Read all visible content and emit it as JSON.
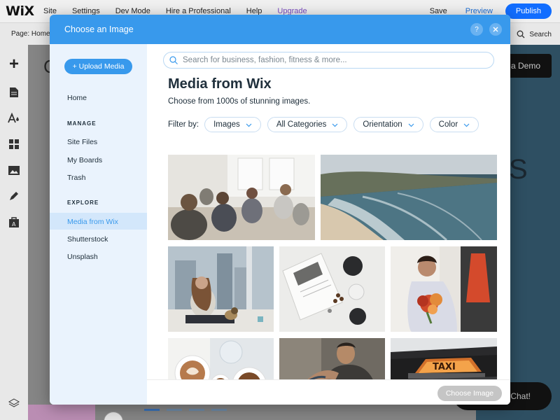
{
  "editor": {
    "logo": "WiX",
    "menu": [
      "Site",
      "Settings",
      "Dev Mode",
      "Hire a Professional",
      "Help",
      "Upgrade"
    ],
    "save": "Save",
    "preview": "Preview",
    "publish": "Publish",
    "page_label": "Page: Home",
    "search": "Search",
    "canvas_demo": "a Demo",
    "canvas_big_letter": "S",
    "canvas_chat": "Chat!",
    "canvas_c": "C"
  },
  "modal": {
    "title": "Choose an Image",
    "help_icon": "question-icon",
    "close_icon": "close-icon",
    "upload_label": "+ Upload Media",
    "nav_home": "Home",
    "section_manage": "MANAGE",
    "nav_site_files": "Site Files",
    "nav_my_boards": "My Boards",
    "nav_trash": "Trash",
    "section_explore": "EXPLORE",
    "nav_media_from_wix": "Media from Wix",
    "nav_shutterstock": "Shutterstock",
    "nav_unsplash": "Unsplash",
    "search_placeholder": "Search for business, fashion, fitness & more...",
    "heading": "Media from Wix",
    "subheading": "Choose from 1000s of stunning images.",
    "filter_label": "Filter by:",
    "filters": [
      "Images",
      "All Categories",
      "Orientation",
      "Color"
    ],
    "choose_button": "Choose Image",
    "colors": {
      "accent": "#3899ec",
      "active_nav_bg": "#d3e7fb",
      "side_bg": "#eaf3fd",
      "disabled_button": "#c5c5c5"
    }
  }
}
